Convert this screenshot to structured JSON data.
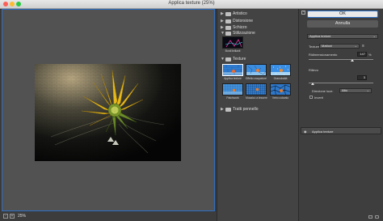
{
  "window": {
    "title": "Applica texture (25%)"
  },
  "preview": {
    "zoom": "25%",
    "zoom_out": "-",
    "zoom_in": "+"
  },
  "gallery": {
    "categories": [
      {
        "label": "Artistico",
        "expanded": false
      },
      {
        "label": "Distorsione",
        "expanded": false
      },
      {
        "label": "Schizzo",
        "expanded": false
      },
      {
        "label": "Stilizzazione",
        "expanded": true
      },
      {
        "label": "Texture",
        "expanded": true
      },
      {
        "label": "Tratti pennello",
        "expanded": false
      }
    ],
    "stylize_filters": [
      {
        "label": "Bordi brillanti"
      }
    ],
    "texture_filters": [
      {
        "label": "Applica texture",
        "selected": true
      },
      {
        "label": "Effetto craquelure",
        "selected": false
      },
      {
        "label": "Granulosità",
        "selected": false
      },
      {
        "label": "Patchwork",
        "selected": false
      },
      {
        "label": "Mosaico a tessere",
        "selected": false
      },
      {
        "label": "Vetro colorato",
        "selected": false
      }
    ]
  },
  "controls": {
    "ok_label": "OK",
    "cancel_label": "Annulla",
    "filter_select": "Applica texture",
    "texture_label": "Texture:",
    "texture_value": "Mattoni",
    "scaling_label": "Ridimensionamento",
    "scaling_value": "147",
    "scaling_unit": "%",
    "scaling_fraction": 0.67,
    "relief_label": "Rilievo",
    "relief_value": "3",
    "relief_fraction": 0.06,
    "light_label": "Direzione luce:",
    "light_value": "Alto",
    "invert_label": "Inverti",
    "invert_checked": false,
    "layer_name": "Applica texture"
  },
  "colors": {
    "accent": "#2e6fc3",
    "panel": "#3e3e3e",
    "preview_bg": "#525252"
  }
}
